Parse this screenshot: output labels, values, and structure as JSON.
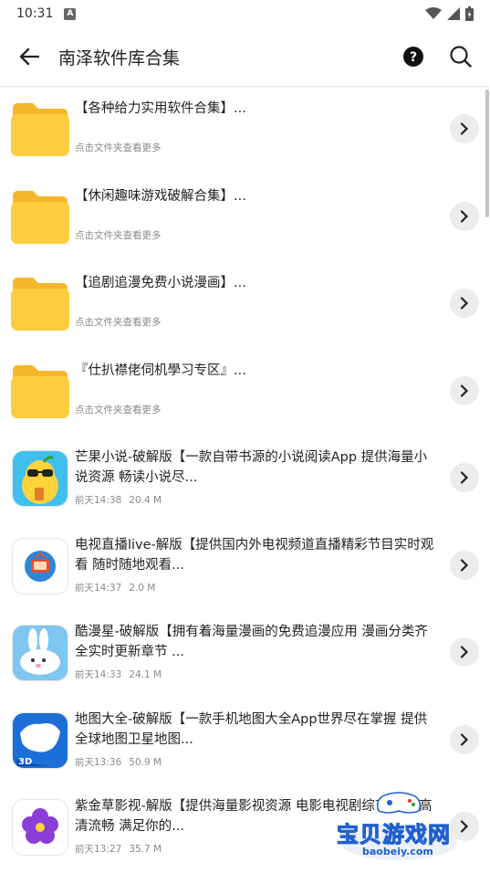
{
  "status_bar": {
    "time": "10:31",
    "notif_letter": "A"
  },
  "header": {
    "title": "南泽软件库合集"
  },
  "items": [
    {
      "type": "folder",
      "title": "【各种给力实用软件合集】...",
      "meta": "点击文件夹查看更多"
    },
    {
      "type": "folder",
      "title": "【休闲趣味游戏破解合集】...",
      "meta": "点击文件夹查看更多"
    },
    {
      "type": "folder",
      "title": "【追剧追漫免费小说漫画】...",
      "meta": "点击文件夹查看更多"
    },
    {
      "type": "folder",
      "title": "『仕扒襟佬伺机學习专区』...",
      "meta": "点击文件夹查看更多"
    },
    {
      "type": "file",
      "title": "芒果小说-破解版【一款自带书源的小说阅读App 提供海量小说资源 畅读小说尽...",
      "date": "前天14:38",
      "size": "20.4 M",
      "icon": "mango-novel-icon"
    },
    {
      "type": "file",
      "title": "电视直播live-解版【提供国内外电视频道直播精彩节目实时观看 随时随地观看...",
      "date": "前天14:37",
      "size": "2.0 M",
      "icon": "tv-live-icon"
    },
    {
      "type": "file",
      "title": "酷漫星-破解版【拥有着海量漫画的免费追漫应用 漫画分类齐全实时更新章节 ...",
      "date": "前天14:33",
      "size": "24.1 M",
      "icon": "rabbit-comic-icon"
    },
    {
      "type": "file",
      "title": "地图大全-破解版【一款手机地图大全App世界尽在掌握 提供全球地图卫星地图...",
      "date": "前天13:36",
      "size": "50.9 M",
      "icon": "china-map-icon"
    },
    {
      "type": "file",
      "title": "紫金草影视-解版【提供海量影视资源 电影电视剧综艺动漫 高清流畅 满足你的...",
      "date": "前天13:27",
      "size": "35.7 M",
      "icon": "purple-flower-icon"
    }
  ],
  "watermark": {
    "text": "宝贝游戏网",
    "url": "baobeiy.com"
  },
  "colors": {
    "folder": "#FFCC3D",
    "folder_back": "#F6B62A",
    "chevron_bg": "#ECECEC",
    "meta_text": "#8A8A8A",
    "watermark_blue": "#1F5FD1"
  }
}
